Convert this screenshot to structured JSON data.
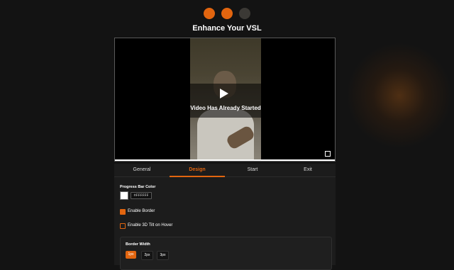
{
  "steps": [
    {
      "state": "active"
    },
    {
      "state": "active"
    },
    {
      "state": "inactive"
    }
  ],
  "page_title": "Enhance Your VSL",
  "video": {
    "overlay_text": "Video Has Already Started",
    "play_icon": "play-icon",
    "fullscreen_icon": "fullscreen-icon",
    "progress_color": "#FFFFFF"
  },
  "tabs": [
    {
      "label": "General",
      "active": false
    },
    {
      "label": "Design",
      "active": true
    },
    {
      "label": "Start",
      "active": false
    },
    {
      "label": "Exit",
      "active": false
    }
  ],
  "design": {
    "progress_bar_color_label": "Progress Bar Color",
    "progress_bar_color_value": "#FFFFFF",
    "enable_border_label": "Enable Border",
    "enable_border_checked": true,
    "enable_3d_tilt_label": "Enable 3D Tilt on Hover",
    "enable_3d_tilt_checked": false,
    "border_width_label": "Border Width",
    "border_width_options": [
      "1px",
      "2px",
      "3px"
    ],
    "border_width_selected": "1px"
  },
  "colors": {
    "accent": "#E2650F",
    "background": "#131313",
    "panel": "#1C1C1C"
  }
}
